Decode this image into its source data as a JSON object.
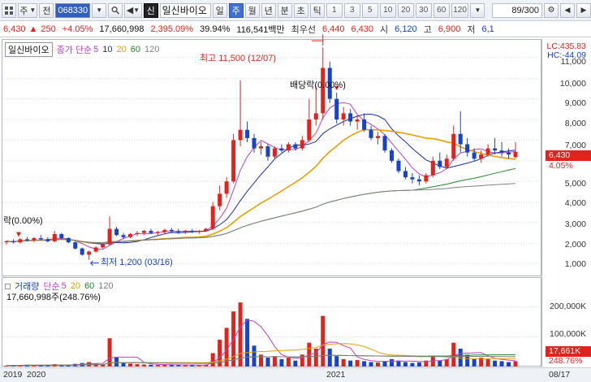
{
  "toolbar": {
    "market": "주",
    "kind": "전",
    "code": "068330",
    "badge": "신",
    "name": "일신바이오",
    "periods": [
      "일",
      "주",
      "월",
      "년",
      "분",
      "초",
      "틱"
    ],
    "active_period": "주",
    "intervals": [
      "1",
      "3",
      "5",
      "10",
      "20",
      "30",
      "60",
      "120"
    ],
    "counter": "89/300"
  },
  "quote": {
    "price": "6,430",
    "change": "250",
    "change_pct": "+4.05%",
    "volume": "17,660,998",
    "volume_pct": "2,395.09%",
    "turnover": "39.94%",
    "amount": "116,541백만",
    "best_ask_label": "최우선",
    "best_ask": "6,440",
    "best_bid": "6,430",
    "open_label": "시",
    "open": "6,120",
    "high_label": "고",
    "high": "6,900",
    "low_label": "저",
    "low": "6,1"
  },
  "price_panel": {
    "title": "일신바이오",
    "legend_label": "종가 단순",
    "ma_periods": [
      "5",
      "10",
      "20",
      "60",
      "120"
    ],
    "lc": "LC:435.83",
    "hc": "HC:-44.09",
    "current_price_tag": "6,430",
    "current_pct_tag": "4.05%",
    "ticks": [
      "11,000",
      "10,000",
      "9,000",
      "8,000",
      "7,000",
      "6,000",
      "5,000",
      "4,000",
      "3,000",
      "2,000",
      "1,000"
    ],
    "high_annotation": "최고 11,500 (12/07)",
    "low_annotation": "최저 1,200 (03/16)",
    "dividend_annotation": "배당락(0.00%)",
    "dividend_annotation_left": "락(0.00%)"
  },
  "volume_panel": {
    "title": "거래량",
    "legend_label": "단순",
    "ma_periods": [
      "5",
      "20",
      "60",
      "120"
    ],
    "volume_text": "17,660,998주(248.76%)",
    "ticks": [
      "200,000K",
      "100,000K"
    ],
    "current_tag": "17,661K",
    "current_pct_tag": "248.76%"
  },
  "x_axis": {
    "labels": [
      "2019",
      "2020",
      "2021",
      "08/17"
    ]
  },
  "colors": {
    "up": "#e0231c",
    "down": "#1742c9",
    "ma5": "#c040c0",
    "ma10": "#1a2fa8",
    "ma20": "#e8a000",
    "ma60": "#1f8a2a",
    "ma120": "#808080"
  },
  "chart_data": {
    "type": "candlestick",
    "period": "weekly",
    "price_range": [
      400,
      11900
    ],
    "candles": [
      [
        2050,
        2150,
        1950,
        2100
      ],
      [
        2100,
        2200,
        2000,
        2050
      ],
      [
        2050,
        2250,
        1980,
        2200
      ],
      [
        2200,
        2300,
        2100,
        2150
      ],
      [
        2150,
        2300,
        2050,
        2250
      ],
      [
        2250,
        2400,
        2150,
        2200
      ],
      [
        2200,
        2300,
        2050,
        2100
      ],
      [
        2100,
        2600,
        2050,
        2450
      ],
      [
        2450,
        2500,
        2200,
        2250
      ],
      [
        2250,
        2300,
        2000,
        2050
      ],
      [
        2050,
        2100,
        1700,
        1750
      ],
      [
        1750,
        1800,
        1400,
        1450
      ],
      [
        1450,
        1650,
        1200,
        1600
      ],
      [
        1600,
        1850,
        1550,
        1800
      ],
      [
        1800,
        2000,
        1750,
        1950
      ],
      [
        1950,
        3300,
        1900,
        2700
      ],
      [
        2700,
        2800,
        2350,
        2400
      ],
      [
        2400,
        2500,
        2200,
        2300
      ],
      [
        2300,
        2500,
        2250,
        2450
      ],
      [
        2450,
        2600,
        2350,
        2500
      ],
      [
        2500,
        2650,
        2400,
        2600
      ],
      [
        2600,
        2700,
        2450,
        2500
      ],
      [
        2500,
        2600,
        2400,
        2550
      ],
      [
        2550,
        2700,
        2450,
        2650
      ],
      [
        2650,
        2750,
        2500,
        2600
      ],
      [
        2600,
        2700,
        2450,
        2550
      ],
      [
        2550,
        2650,
        2450,
        2600
      ],
      [
        2600,
        2700,
        2500,
        2550
      ],
      [
        2550,
        2650,
        2450,
        2600
      ],
      [
        2600,
        2750,
        2550,
        2700
      ],
      [
        2700,
        4000,
        2650,
        3800
      ],
      [
        3800,
        4800,
        3600,
        4400
      ],
      [
        4400,
        5200,
        4200,
        5000
      ],
      [
        5000,
        7300,
        4900,
        7000
      ],
      [
        7000,
        9900,
        6700,
        7500
      ],
      [
        7500,
        7900,
        6900,
        7100
      ],
      [
        7100,
        7300,
        6400,
        6600
      ],
      [
        6600,
        6900,
        6300,
        6700
      ],
      [
        6700,
        6800,
        6000,
        6200
      ],
      [
        6200,
        6700,
        6100,
        6600
      ],
      [
        6600,
        6800,
        6400,
        6500
      ],
      [
        6500,
        6900,
        6400,
        6800
      ],
      [
        6800,
        6900,
        6500,
        6600
      ],
      [
        6600,
        7200,
        6500,
        7000
      ],
      [
        7000,
        9000,
        6900,
        8000
      ],
      [
        8000,
        9600,
        7700,
        8300
      ],
      [
        8300,
        11500,
        8000,
        10500
      ],
      [
        10500,
        10800,
        8800,
        9000
      ],
      [
        9000,
        9300,
        7800,
        8000
      ],
      [
        8000,
        8600,
        7700,
        8300
      ],
      [
        8300,
        8500,
        7700,
        7900
      ],
      [
        7900,
        8200,
        7500,
        8000
      ],
      [
        8000,
        8300,
        7400,
        7500
      ],
      [
        7500,
        7700,
        7000,
        7100
      ],
      [
        7100,
        7400,
        6800,
        7200
      ],
      [
        7200,
        7300,
        6400,
        6500
      ],
      [
        6500,
        6600,
        5900,
        6000
      ],
      [
        6000,
        6100,
        5400,
        5500
      ],
      [
        5500,
        5700,
        5100,
        5200
      ],
      [
        5200,
        5400,
        4900,
        5100
      ],
      [
        5100,
        5300,
        4800,
        5000
      ],
      [
        5000,
        5400,
        4900,
        5300
      ],
      [
        5300,
        6200,
        5200,
        6000
      ],
      [
        6000,
        6400,
        5600,
        5700
      ],
      [
        5700,
        6300,
        5600,
        6100
      ],
      [
        6100,
        7700,
        6000,
        7300
      ],
      [
        7300,
        8400,
        6400,
        6800
      ],
      [
        6800,
        7100,
        6200,
        6400
      ],
      [
        6400,
        6600,
        6000,
        6100
      ],
      [
        6100,
        6500,
        5900,
        6300
      ],
      [
        6300,
        6800,
        6200,
        6600
      ],
      [
        6600,
        7100,
        6300,
        6500
      ],
      [
        6500,
        6900,
        6200,
        6400
      ],
      [
        6400,
        6600,
        6100,
        6300
      ],
      [
        6180,
        6900,
        6120,
        6430
      ]
    ],
    "ma_labels": [
      "5",
      "10",
      "20",
      "60",
      "120"
    ],
    "volume_range": [
      0,
      300000
    ],
    "volumes": [
      3000,
      4000,
      5000,
      6000,
      4000,
      5000,
      3000,
      8000,
      6000,
      4000,
      9000,
      12000,
      15000,
      10000,
      8000,
      95000,
      30000,
      15000,
      10000,
      8000,
      7000,
      6000,
      5000,
      7000,
      6000,
      5000,
      4000,
      5000,
      4000,
      6000,
      45000,
      90000,
      130000,
      185000,
      215000,
      160000,
      70000,
      40000,
      30000,
      35000,
      25000,
      30000,
      20000,
      40000,
      80000,
      60000,
      170000,
      60000,
      35000,
      25000,
      20000,
      22000,
      18000,
      15000,
      14000,
      18000,
      25000,
      20000,
      15000,
      12000,
      14000,
      20000,
      35000,
      20000,
      25000,
      80000,
      60000,
      40000,
      25000,
      30000,
      25000,
      20000,
      18000,
      15000,
      17661
    ]
  }
}
